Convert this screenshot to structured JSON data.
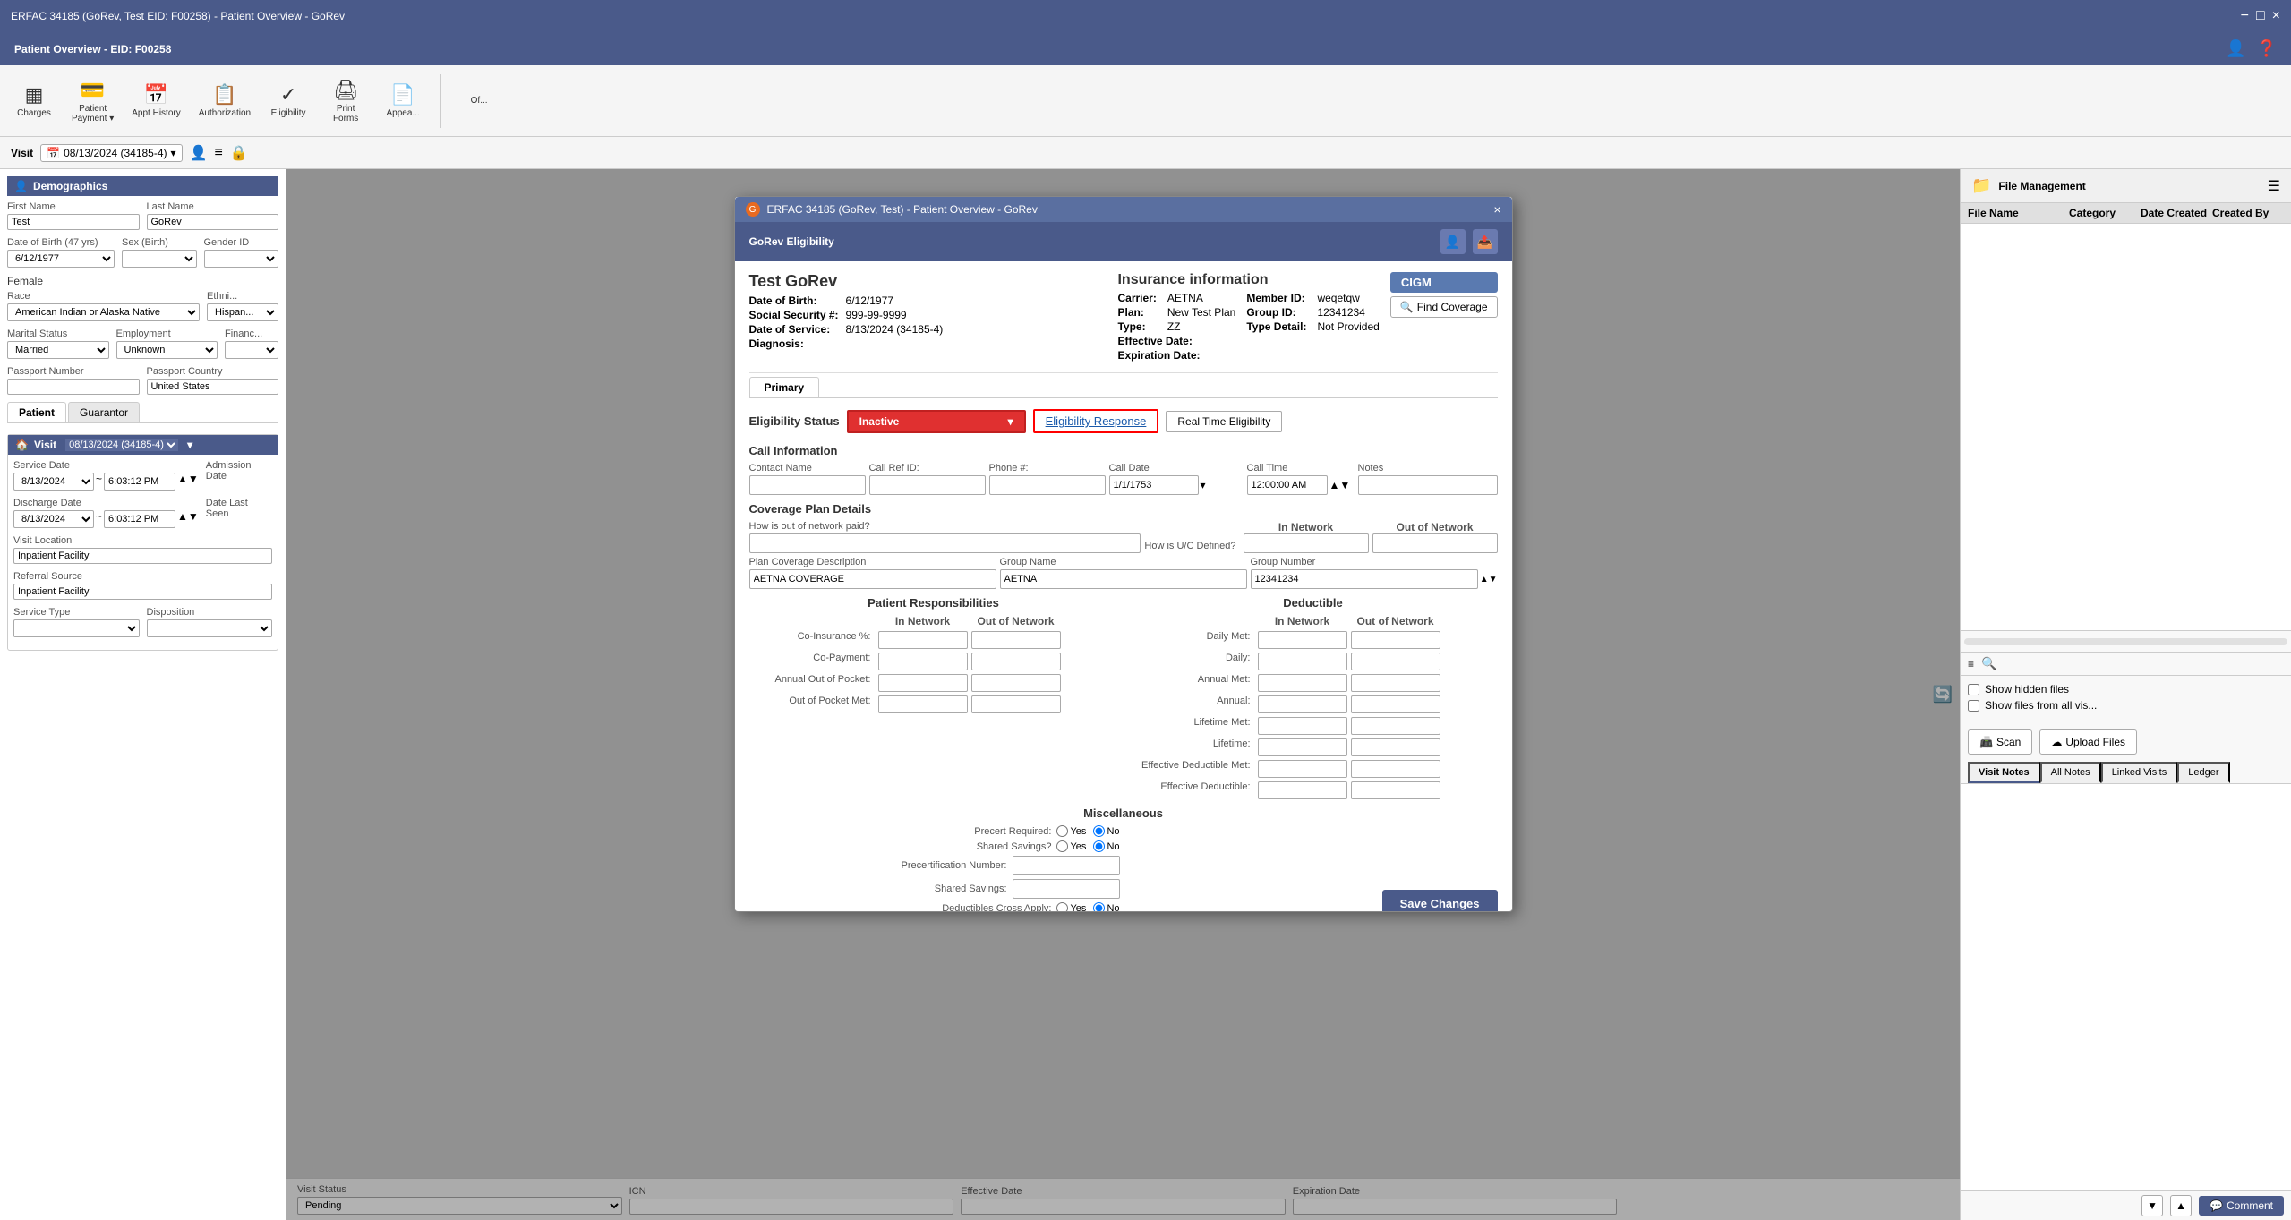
{
  "window": {
    "title": "ERFAC 34185 (GoRev, Test EID: F00258) - Patient Overview - GoRev",
    "close": "×",
    "minimize": "−",
    "maximize": "□"
  },
  "main_title": "Patient Overview - EID: F00258",
  "toolbar": {
    "items": [
      {
        "id": "charges",
        "icon": "▦",
        "label": "Charges"
      },
      {
        "id": "patient-payment",
        "icon": "👤",
        "label": "Patient\nPayment ▾"
      },
      {
        "id": "appt-history",
        "icon": "📅",
        "label": "Appt History"
      },
      {
        "id": "authorization",
        "icon": "📋",
        "label": "Authorization"
      },
      {
        "id": "eligibility",
        "icon": "✓",
        "label": "Eligibility"
      },
      {
        "id": "print-forms",
        "icon": "🖨",
        "label": "Print\nForms"
      },
      {
        "id": "appeals",
        "icon": "📄",
        "label": "Appea..."
      }
    ]
  },
  "visit_bar": {
    "label": "Visit",
    "date": "08/13/2024 (34185-4)",
    "icons": [
      "👤",
      "≡",
      "🔒"
    ]
  },
  "demographics": {
    "section_title": "Demographics",
    "first_name_label": "First Name",
    "first_name": "Test",
    "last_name_label": "Last Name",
    "last_name": "GoRev",
    "dob_label": "Date of Birth (47 yrs)",
    "dob": "6/12/1977",
    "sex_label": "Sex (Birth)",
    "sex": "",
    "gender_label": "Gender ID",
    "gender": "",
    "sex_value": "Female",
    "race_label": "Race",
    "race": "American Indian or Alaska Native",
    "ethnicity_label": "Ethni...",
    "ethnicity": "Hispan...",
    "marital_label": "Marital Status",
    "marital": "Married",
    "employment_label": "Employment",
    "employment": "Unknown",
    "finance_label": "Financ...",
    "passport_label": "Passport Number",
    "passport": "",
    "passport_country_label": "Passport Country",
    "passport_country": "United States",
    "tabs": [
      "Patient",
      "Guarantor"
    ]
  },
  "visit_section": {
    "label": "Visit",
    "date": "08/13/2024 (34185-4)",
    "service_date_label": "Service Date",
    "service_date": "8/13/2024",
    "service_time": "6:03:12 PM",
    "admission_label": "Admission Date",
    "discharge_label": "Discharge Date",
    "discharge_date": "8/13/2024",
    "discharge_time": "6:03:12 PM",
    "date_last_seen_label": "Date Last Seen",
    "visit_location_label": "Visit Location",
    "visit_location": "Inpatient Facility",
    "referral_label": "Referral Source",
    "referral": "Inpatient Facility",
    "service_type_label": "Service Type",
    "disposition_label": "Disposition"
  },
  "modal": {
    "title_bar": "ERFAC 34185 (GoRev, Test) - Patient Overview - GoRev",
    "header": "GoRev Eligibility",
    "patient_name": "Test GoRev",
    "insurance_title": "Insurance information",
    "cigm": "CIGM",
    "find_coverage": "Find Coverage",
    "dob_label": "Date of Birth:",
    "dob": "6/12/1977",
    "diagnosis_label": "Diagnosis:",
    "diagnosis": "",
    "ssn_label": "Social Security #:",
    "ssn": "999-99-9999",
    "date_of_service_label": "Date of Service:",
    "date_of_service": "8/13/2024 (34185-4)",
    "carrier_label": "Carrier:",
    "carrier": "AETNA",
    "plan_label": "Plan:",
    "plan": "New Test Plan",
    "type_label": "Type:",
    "type": "ZZ",
    "member_id_label": "Member ID:",
    "member_id": "weqetqw",
    "group_id_label": "Group ID:",
    "group_id": "12341234",
    "type_detail_label": "Type Detail:",
    "type_detail": "Not Provided",
    "effective_date_label": "Effective Date:",
    "effective_date": "",
    "expiration_date_label": "Expiration Date:",
    "expiration_date": "",
    "primary_tab": "Primary",
    "eligibility_status_label": "Eligibility Status",
    "eligibility_status": "Inactive",
    "eligibility_response_btn": "Eligibility Response",
    "real_time_btn": "Real Time Eligibility",
    "call_information": "Call Information",
    "call_labels": {
      "contact_name": "Contact Name",
      "call_ref_id": "Call Ref ID:",
      "phone": "Phone #:",
      "call_date": "Call Date",
      "call_time": "Call Time",
      "notes": "Notes"
    },
    "call_values": {
      "contact_name": "",
      "call_ref_id": "",
      "phone": "",
      "call_date": "1/1/1753",
      "call_time": "12:00:00 AM",
      "notes": ""
    },
    "coverage_plan_details": "Coverage Plan Details",
    "how_network_paid": "How is out of network paid?",
    "in_network_label": "In Network",
    "out_of_network_label": "Out of Network",
    "how_uc_defined": "How is U/C Defined?",
    "plan_coverage_desc_label": "Plan Coverage Description",
    "plan_coverage_desc": "AETNA COVERAGE",
    "group_name_label": "Group Name",
    "group_name": "AETNA",
    "group_number_label": "Group Number",
    "group_number": "12341234",
    "patient_responsibilities": "Patient Responsibilities",
    "in_network": "In Network",
    "out_of_network": "Out of Network",
    "co_insurance_label": "Co-Insurance %:",
    "co_payment_label": "Co-Payment:",
    "annual_out_of_pocket_label": "Annual Out of Pocket:",
    "out_of_pocket_met_label": "Out of Pocket Met:",
    "deductible": "Deductible",
    "daily_met_label": "Daily Met:",
    "daily_label": "Daily:",
    "annual_met_label": "Annual Met:",
    "annual_label": "Annual:",
    "lifetime_met_label": "Lifetime Met:",
    "lifetime_label": "Lifetime:",
    "effective_deductible_met_label": "Effective Deductible Met:",
    "effective_deductible_label": "Effective Deductible:",
    "miscellaneous": "Miscellaneous",
    "precert_required_label": "Precert Required:",
    "shared_savings_label": "Shared Savings?",
    "precertification_number_label": "Precertification Number:",
    "shared_savings_num_label": "Shared Savings:",
    "deductibles_cross_apply_label": "Deductibles Cross Apply:",
    "save_changes": "Save Changes"
  },
  "file_management": {
    "title": "File Management",
    "columns": [
      "File Name",
      "Category",
      "Date Created",
      "Created By"
    ],
    "show_hidden": "Show hidden files",
    "show_all_visits": "Show files from all vis...",
    "scan_btn": "Scan",
    "upload_btn": "Upload Files"
  },
  "visit_notes": {
    "tabs": [
      "Visit Notes",
      "All Notes",
      "Linked Visits",
      "Ledger"
    ]
  },
  "bottom_status": {
    "visit_status_label": "Visit Status",
    "visit_status": "Pending",
    "icn_label": "ICN",
    "effective_date_label": "Effective Date",
    "expiration_date_label": "Expiration Date"
  },
  "colors": {
    "header_bg": "#4a5a8a",
    "inactive_red": "#d03030",
    "modal_title_bg": "#5a6fa0"
  }
}
